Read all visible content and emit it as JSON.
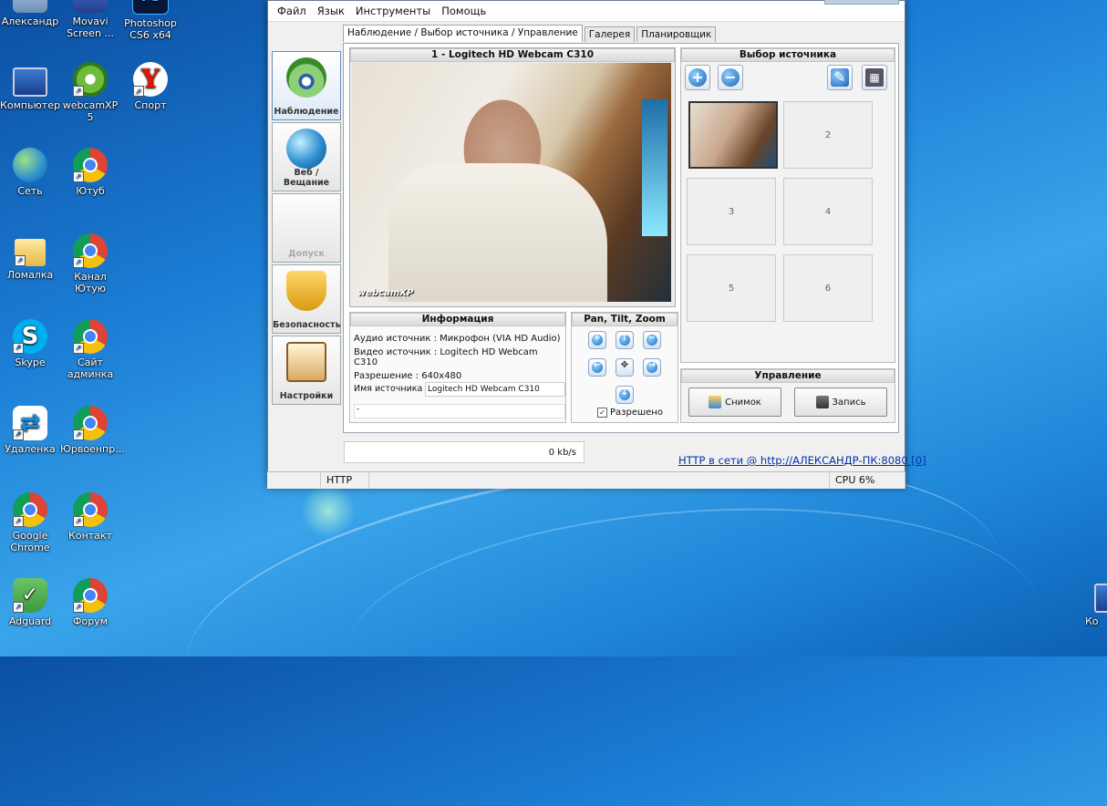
{
  "desktop": {
    "icons": [
      {
        "label": "Александр",
        "icon": "user-folder-icon"
      },
      {
        "label": "Movavi Screen ...",
        "icon": "movavi-icon"
      },
      {
        "label": "Photoshop CS6 x64",
        "icon": "photoshop-icon"
      },
      {
        "label": "Компьютер",
        "icon": "computer-icon"
      },
      {
        "label": "webcamXP 5",
        "icon": "webcamxp-icon"
      },
      {
        "label": "Спорт",
        "icon": "yandex-icon"
      },
      {
        "label": "Сеть",
        "icon": "network-icon"
      },
      {
        "label": "Ютуб",
        "icon": "chrome-icon"
      },
      {
        "label": "Ломалка",
        "icon": "folder-icon"
      },
      {
        "label": "Канал Ютую",
        "icon": "chrome-icon"
      },
      {
        "label": "Skype",
        "icon": "skype-icon"
      },
      {
        "label": "Сайт админка",
        "icon": "chrome-icon"
      },
      {
        "label": "Удаленка",
        "icon": "teamviewer-icon"
      },
      {
        "label": "Юрвоенпр...",
        "icon": "chrome-icon"
      },
      {
        "label": "Google Chrome",
        "icon": "chrome-icon"
      },
      {
        "label": "Контакт",
        "icon": "chrome-icon"
      },
      {
        "label": "Adguard",
        "icon": "adguard-icon"
      },
      {
        "label": "Форум",
        "icon": "chrome-icon"
      }
    ],
    "edge_label": "Ко"
  },
  "menu": [
    "Файл",
    "Язык",
    "Инструменты",
    "Помощь"
  ],
  "tabs": [
    "Наблюдение / Выбор источника / Управление",
    "Галерея",
    "Планировщик"
  ],
  "sidebar": [
    "Наблюдение",
    "Веб / Вещание",
    "Допуск",
    "Безопасность",
    "Настройки"
  ],
  "video": {
    "title": "1 - Logitech HD Webcam C310",
    "watermark": "webcamXP"
  },
  "info": {
    "title": "Информация",
    "audio": "Аудио источник : Микрофон (VIA HD Audio)",
    "video": "Видео источник : Logitech HD Webcam C310",
    "resolution": "Разрешение : 640x480",
    "name_label": "Имя источника :",
    "name_value": "Logitech HD Webcam C310",
    "extra": "-"
  },
  "ptz": {
    "title": "Pan, Tilt, Zoom",
    "checkbox_label": "Разрешено"
  },
  "source": {
    "title": "Выбор источника",
    "slots": [
      "2",
      "3",
      "4",
      "5",
      "6"
    ]
  },
  "control": {
    "title": "Управление",
    "snapshot": "Снимок",
    "record": "Запись"
  },
  "rate": "0 kb/s",
  "http_link": "HTTP в сети @ http://АЛЕКСАНДР-ПК:8080 [0]",
  "status": {
    "left": "HTTP",
    "cpu": "CPU 6%"
  }
}
